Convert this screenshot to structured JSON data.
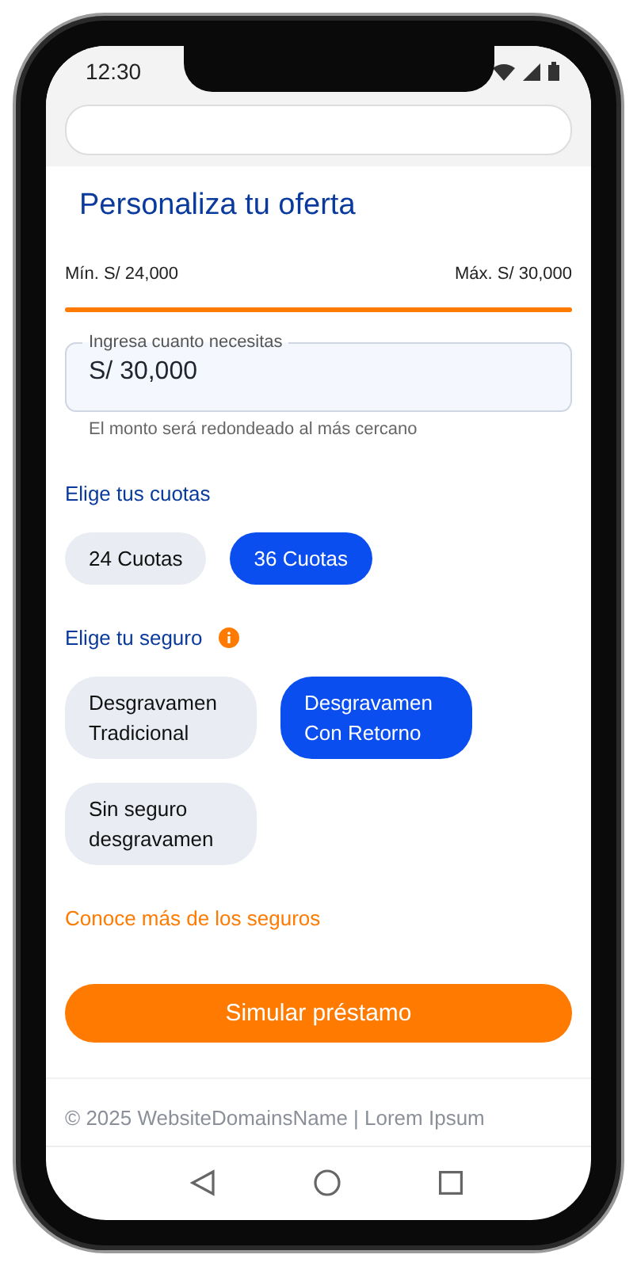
{
  "status_bar": {
    "time": "12:30"
  },
  "title": "Personaliza tu oferta",
  "range": {
    "min": "Mín. S/ 24,000",
    "max": "Máx. S/ 30,000",
    "level": 1
  },
  "amount_field": {
    "label": "Ingresa cuanto necesitas",
    "value": "S/ 30,000",
    "hint": "El monto será redondeado al más cercano"
  },
  "installments": {
    "label": "Elige tus cuotas",
    "options": [
      {
        "label": "24 Cuotas",
        "selected": false
      },
      {
        "label": "36 Cuotas",
        "selected": true
      }
    ]
  },
  "insurance": {
    "label": "Elige tu seguro",
    "options": [
      {
        "label": "Desgravamen Tradicional",
        "selected": false
      },
      {
        "label": "Desgravamen Con Retorno",
        "selected": true
      },
      {
        "label": "Sin seguro desgravamen",
        "selected": false
      }
    ]
  },
  "link": "Conoce más de los seguros",
  "button": "Simular préstamo",
  "footer": "© 2025 WebsiteDomainsName | Lorem Ipsum"
}
